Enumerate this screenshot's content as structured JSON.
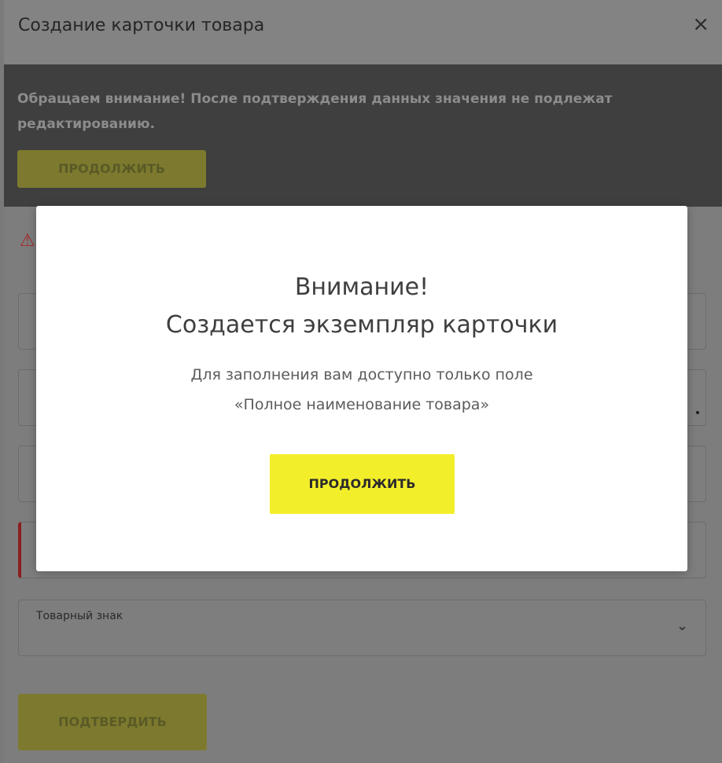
{
  "dialog": {
    "title": "Создание карточки товара",
    "close_icon": "×"
  },
  "notice": {
    "text": "Обращаем внимание! После подтверждения данных значения не подлежат редактированию.",
    "continue_label": "ПРОДОЛЖИТЬ"
  },
  "form": {
    "warning_icon": "⚠",
    "trademark_label": "Товарный знак",
    "chevron_icon": "⌄",
    "confirm_label": "ПОДТВЕРДИТЬ"
  },
  "modal": {
    "title_line1": "Внимание!",
    "title_line2": "Создается экземпляр карточки",
    "text_line1": "Для заполнения вам доступно только поле",
    "text_line2": "«Полное наименование товара»",
    "continue_label": "ПРОДОЛЖИТЬ"
  },
  "colors": {
    "accent_yellow": "#f3ee2a",
    "overlay_gray": "#7d7d7d",
    "notice_bg": "#3f3f3f",
    "error_red": "#8a1d1d"
  }
}
